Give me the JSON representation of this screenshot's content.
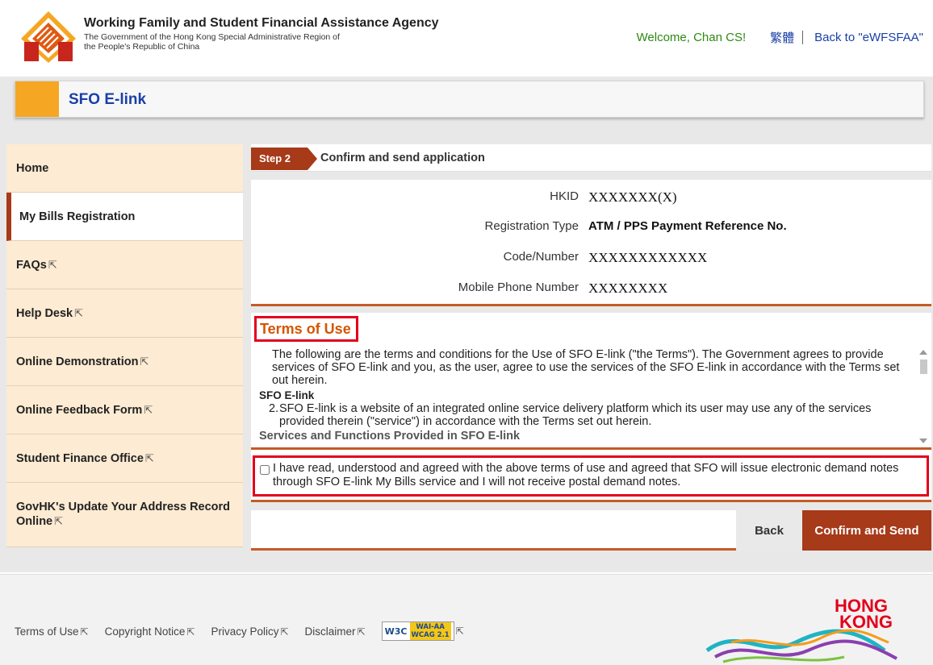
{
  "header": {
    "agency_name": "Working Family and Student Financial Assistance Agency",
    "agency_sub": "The Government of the Hong Kong Special Administrative Region of the People's Republic of China",
    "welcome": "Welcome, Chan CS!",
    "language": "繁體",
    "back_link": "Back to \"eWFSFAA\""
  },
  "titlebar": {
    "title": "SFO E-link"
  },
  "sidebar": {
    "items": [
      {
        "label": "Home",
        "external": false
      },
      {
        "label": "My Bills Registration",
        "external": false,
        "active": true
      },
      {
        "label": "FAQs",
        "external": true
      },
      {
        "label": "Help Desk",
        "external": true
      },
      {
        "label": "Online Demonstration",
        "external": true
      },
      {
        "label": "Online Feedback Form",
        "external": true
      },
      {
        "label": "Student Finance Office",
        "external": true
      },
      {
        "label": "GovHK's Update Your Address Record Online",
        "external": true
      }
    ],
    "ext_glyph": "⇱"
  },
  "step": {
    "tag": "Step 2",
    "title": "Confirm and send application"
  },
  "info": {
    "hkid_label": "HKID",
    "hkid_value": "XXXXXXX(X)",
    "regtype_label": "Registration Type",
    "regtype_value": "ATM / PPS Payment Reference No.",
    "code_label": "Code/Number",
    "code_value": "XXXXXXXXXXXX",
    "mobile_label": "Mobile Phone Number",
    "mobile_value": "XXXXXXXX"
  },
  "terms": {
    "heading": "Terms of Use",
    "intro": "The following are the terms and conditions for the Use of SFO E-link (\"the Terms\"). The Government agrees to provide services of SFO E-link and you, as the user, agree to use the services of the SFO E-link in accordance with the Terms set out herein.",
    "sub_heading": "SFO E-link",
    "item_num": "2.",
    "item_text": "SFO E-link is a website of an integrated online service delivery platform which its user may use any of the services provided therein (\"service\") in accordance with the Terms set out herein.",
    "next_heading": "Services and Functions Provided in SFO E-link"
  },
  "agree": {
    "text": "I have read, understood and agreed with the above terms of use and agreed that SFO will issue electronic demand notes through SFO E-link My Bills service and I will not receive postal demand notes.",
    "checked": false
  },
  "actions": {
    "back": "Back",
    "confirm": "Confirm and Send"
  },
  "footer": {
    "links": [
      "Terms of Use",
      "Copyright Notice",
      "Privacy Policy",
      "Disclaimer"
    ],
    "w3c": "W3C",
    "wai": "WAI-AA",
    "wcag": "WCAG 2.1",
    "brand_line1": "HONG",
    "brand_line2": "KONG"
  },
  "colors": {
    "accent_orange": "#f5a623",
    "brand_red": "#a63a19",
    "highlight_red": "#e3001b",
    "link_blue": "#1a3fa8",
    "welcome_green": "#2d8a12"
  }
}
